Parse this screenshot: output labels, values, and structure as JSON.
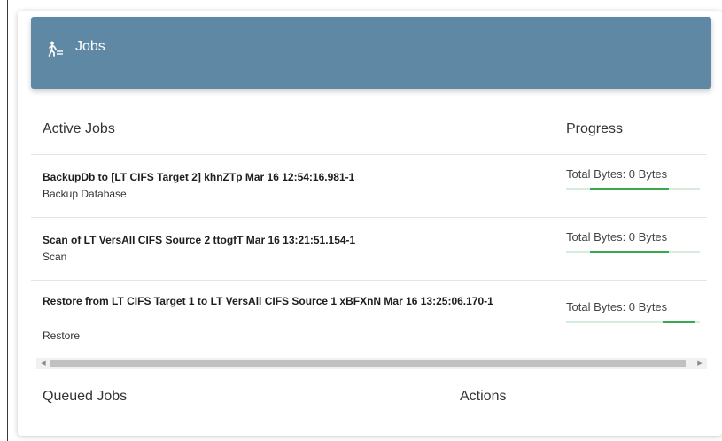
{
  "header": {
    "title": "Jobs",
    "icon": "person-walking-list-icon",
    "background_color": "#5f88a4"
  },
  "active_jobs": {
    "heading": "Active Jobs",
    "progress_heading": "Progress",
    "rows": [
      {
        "name": "BackupDb to [LT CIFS Target 2] khnZTp Mar 16 12:54:16.981-1",
        "type": "Backup Database",
        "progress_label": "Total Bytes: 0 Bytes",
        "progress": {
          "start": 0.18,
          "end": 0.77
        }
      },
      {
        "name": "Scan of LT VersAll CIFS Source 2 ttogfT Mar 16 13:21:51.154-1",
        "type": "Scan",
        "progress_label": "Total Bytes: 0 Bytes",
        "progress": {
          "start": 0.18,
          "end": 0.77
        }
      },
      {
        "name": "Restore from LT CIFS Target 1 to LT VersAll CIFS Source 1 xBFXnN Mar 16 13:25:06.170-1",
        "type": "Restore",
        "progress_label": "Total Bytes: 0 Bytes",
        "progress": {
          "start": 0.72,
          "end": 0.96
        }
      }
    ]
  },
  "queued_jobs": {
    "heading": "Queued Jobs",
    "actions_heading": "Actions"
  },
  "colors": {
    "progress_fill": "#39a950",
    "progress_track": "#d6ecdc"
  }
}
